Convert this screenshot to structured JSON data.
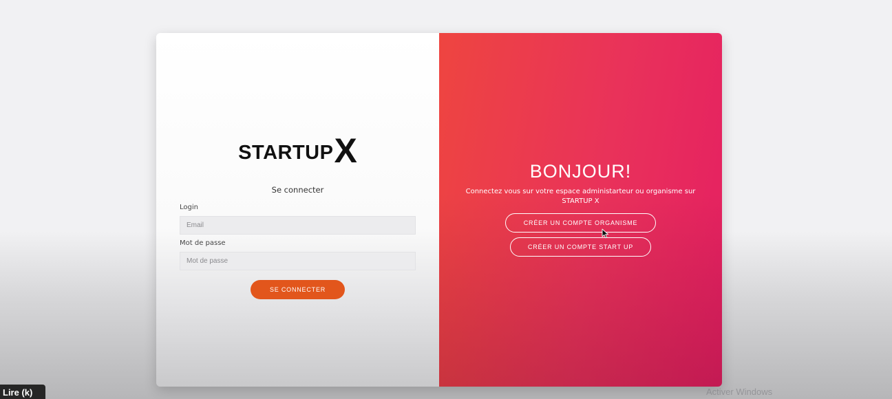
{
  "login_panel": {
    "logo_main": "STARTUP",
    "logo_accent": "X",
    "title": "Se connecter",
    "login_label": "Login",
    "email_placeholder": "Email",
    "email_value": "",
    "password_label": "Mot de passe",
    "password_placeholder": "Mot de passe",
    "password_value": "",
    "submit_label": "SE CONNECTER",
    "submit_color": "#e2561c"
  },
  "welcome_panel": {
    "heading": "BONJOUR!",
    "description": "Connectez vous sur votre espace administarteur ou organisme sur STARTUP X",
    "create_organisme_label": "CRÉER UN COMPTE ORGANISME",
    "create_startup_label": "CRÉER UN COMPTE START UP",
    "gradient_start": "#ee4540",
    "gradient_end": "#e51f62"
  },
  "overlay": {
    "reader_badge": "Lire (k)",
    "watermark": "Activer Windows"
  },
  "icons": {
    "cursor": "mouse-pointer-icon"
  }
}
